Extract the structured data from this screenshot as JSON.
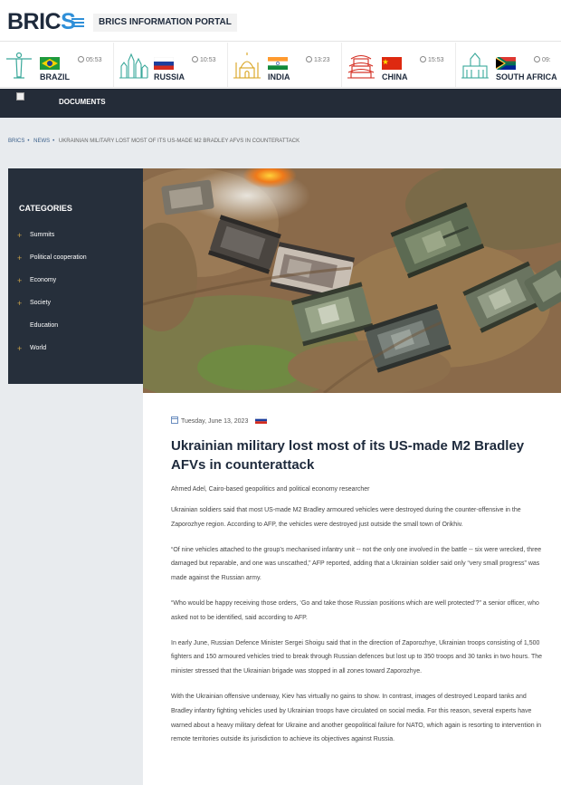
{
  "header": {
    "logo_main": "BRIC",
    "logo_accent": "S",
    "portal_title": "BRICS INFORMATION PORTAL"
  },
  "countries": [
    {
      "name": "BRAZIL",
      "time": "05:53",
      "landmark": "christ-statue-icon",
      "flag": "brazil-flag"
    },
    {
      "name": "RUSSIA",
      "time": "10:53",
      "landmark": "kremlin-icon",
      "flag": "russia-flag"
    },
    {
      "name": "INDIA",
      "time": "13:23",
      "landmark": "taj-mahal-icon",
      "flag": "india-flag"
    },
    {
      "name": "CHINA",
      "time": "15:53",
      "landmark": "pagoda-icon",
      "flag": "china-flag"
    },
    {
      "name": "SOUTH AFRICA",
      "time": "09:",
      "landmark": "city-hall-icon",
      "flag": "south-africa-flag"
    }
  ],
  "nav": {
    "documents": "DOCUMENTS"
  },
  "breadcrumb": {
    "items": [
      "BRICS",
      "NEWS"
    ],
    "current": "UKRAINIAN MILITARY LOST MOST OF ITS US-MADE M2 BRADLEY AFVS IN COUNTERATTACK"
  },
  "categories": {
    "title": "CATEGORIES",
    "items": [
      {
        "label": "Summits",
        "plus": "+"
      },
      {
        "label": "Political cooperation",
        "plus": "+"
      },
      {
        "label": "Economy",
        "plus": "+"
      },
      {
        "label": "Society",
        "plus": "+"
      },
      {
        "label": "Education",
        "plus": ""
      },
      {
        "label": "World",
        "plus": "+"
      }
    ]
  },
  "article": {
    "date": "Tuesday, June 13, 2023",
    "title": "Ukrainian military lost most of its US-made M2 Bradley AFVs in counterattack",
    "author": "Ahmed Adel, Cairo-based geopolitics and political economy researcher",
    "paragraphs": [
      "Ukrainian soldiers said that most US-made M2 Bradley armoured vehicles were destroyed during the counter-offensive in the Zaporozhye region. According to AFP, the vehicles were destroyed just outside the small town of Orikhiv.",
      "“Of nine vehicles attached to the group’s mechanised infantry unit -- not the only one involved in the battle -- six were wrecked, three damaged but reparable, and one was unscathed,” AFP reported, adding that a Ukrainian soldier said only “very small progress” was made against the Russian army.",
      "“Who would be happy receiving those orders, ‘Go and take those Russian positions which are well protected’?” a senior officer, who asked not to be identified, said according to AFP.",
      "In early June, Russian Defence Minister Sergei Shoigu said that in the direction of Zaporozhye, Ukrainian troops consisting of 1,500 fighters and 150 armoured vehicles tried to break through Russian defences but lost up to 350 troops and 30 tanks in two hours. The minister stressed that the Ukrainian brigade was stopped in all zones toward Zaporozhye.",
      "With the Ukrainian offensive underway, Kiev has virtually no gains to show. In contrast, images of destroyed Leopard tanks and Bradley infantry fighting vehicles used by Ukrainian troops have circulated on social media. For this reason, several experts have warned about a heavy military defeat for Ukraine and another geopolitical failure for NATO, which again is resorting to intervention in remote territories outside its jurisdiction to achieve its objectives against Russia."
    ]
  },
  "colors": {
    "navy": "#242c38",
    "accent_blue": "#2f8fd8",
    "gold": "#c9a24a",
    "landmark_teal": "#3aa89a"
  }
}
